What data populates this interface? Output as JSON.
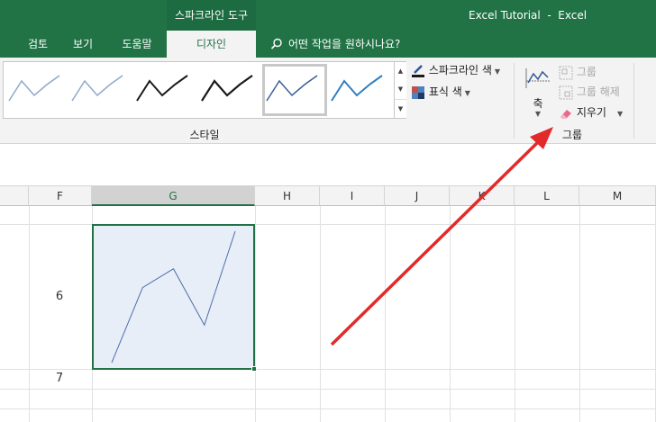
{
  "title_bar": {
    "context_group": "스파크라인 도구",
    "window_title": "Excel Tutorial  -  Excel"
  },
  "tabs": [
    "검토",
    "보기",
    "도움말",
    "디자인"
  ],
  "tell_me": "어떤 작업을 원하시나요?",
  "ribbon": {
    "style_group_label": "스타일",
    "sparkline_color": "스파크라인 색",
    "marker_color": "표식 색",
    "axis": "축",
    "group": "그룹",
    "ungroup": "그룹 해제",
    "clear": "지우기",
    "group_section_label": "그룹",
    "styles": [
      {
        "color": "#8ea9c9",
        "selected": false
      },
      {
        "color": "#8ea9c9",
        "selected": false
      },
      {
        "color": "#1a1a1a",
        "selected": false
      },
      {
        "color": "#1a1a1a",
        "selected": false
      },
      {
        "color": "#3a5f95",
        "selected": true
      },
      {
        "color": "#2f7ec1",
        "selected": false
      }
    ]
  },
  "grid": {
    "columns": [
      "F",
      "G",
      "H",
      "I",
      "J",
      "K",
      "L",
      "M"
    ],
    "selected_column": "G",
    "rows": [
      "6",
      "7"
    ],
    "sparkline_values": [
      1,
      5,
      6,
      3,
      8
    ]
  },
  "colors": {
    "excel_green": "#217346",
    "arrow_red": "#e32a2a",
    "sparkline": "#4a6ea9"
  }
}
